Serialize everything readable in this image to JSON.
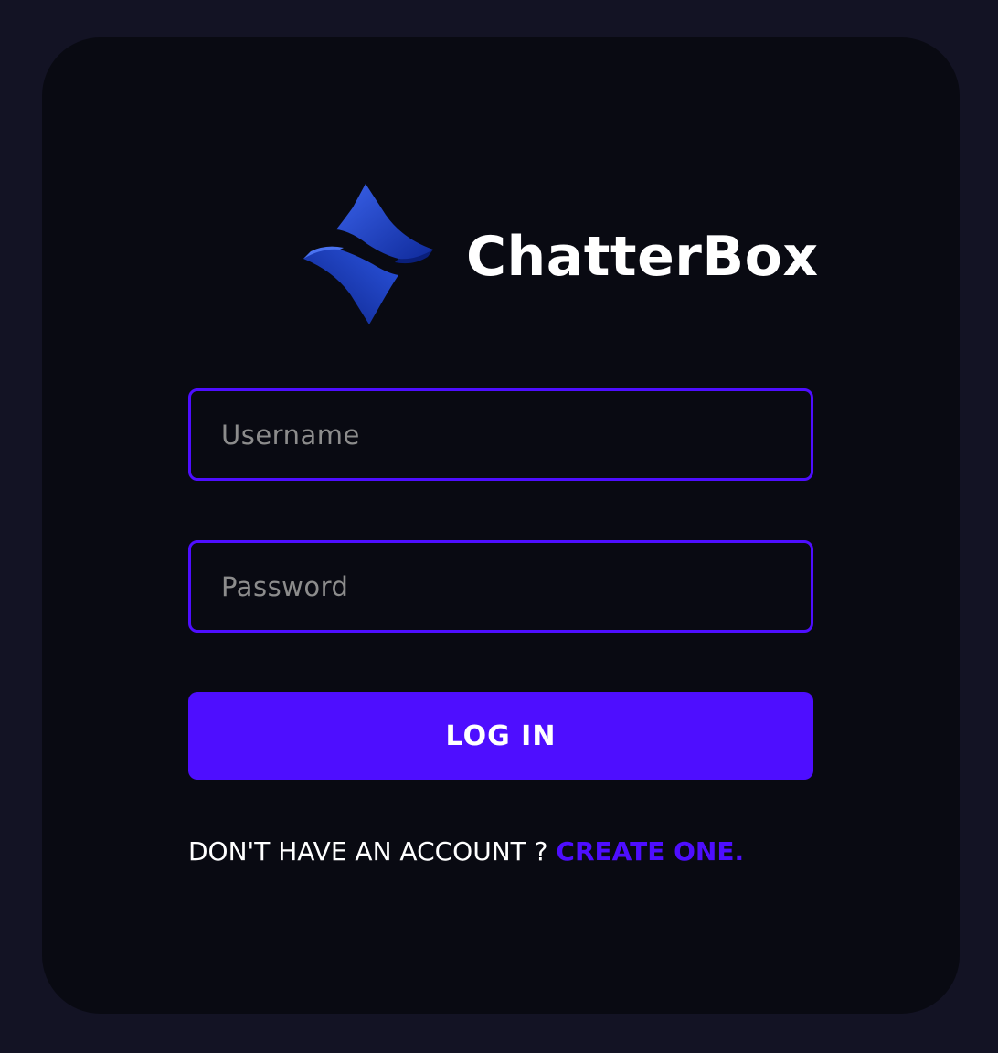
{
  "brand": {
    "name": "ChatterBox",
    "logo_icon": "chatterbox-logo-icon"
  },
  "form": {
    "username": {
      "placeholder": "Username",
      "value": ""
    },
    "password": {
      "placeholder": "Password",
      "value": ""
    },
    "submit_label": "LOG IN"
  },
  "footer": {
    "prompt_text": "DON'T HAVE AN ACCOUNT ? ",
    "link_label": "CREATE ONE."
  },
  "colors": {
    "page_background": "#131324",
    "card_background": "#090a12",
    "accent": "#4e0eff",
    "text": "#ffffff",
    "placeholder": "#8c8c8c",
    "logo_blue": "#1f44c9"
  }
}
